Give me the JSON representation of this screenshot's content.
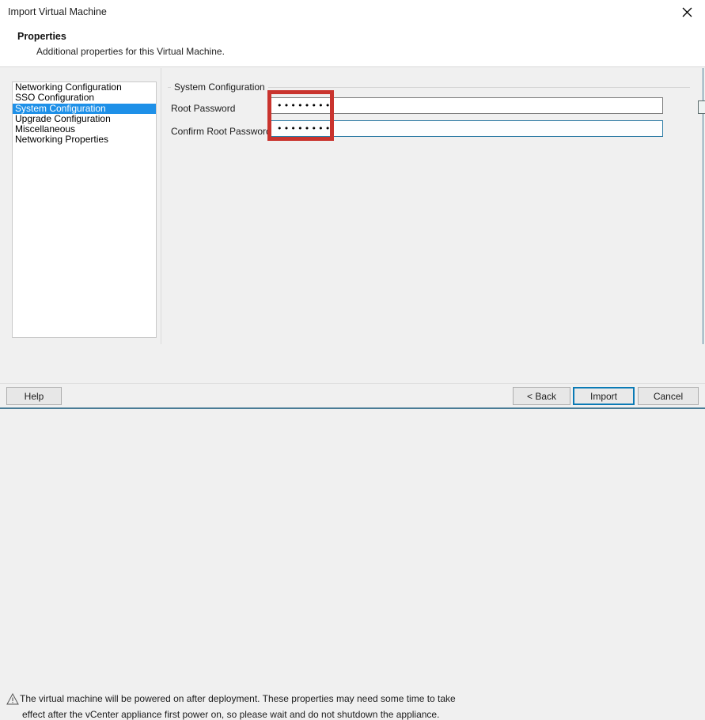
{
  "window": {
    "title": "Import Virtual Machine",
    "close_icon": "close-icon"
  },
  "header": {
    "title": "Properties",
    "subtitle": "Additional properties for this Virtual Machine."
  },
  "sidebar": {
    "items": [
      {
        "label": "Networking Configuration",
        "selected": false
      },
      {
        "label": "SSO Configuration",
        "selected": false
      },
      {
        "label": "System Configuration",
        "selected": true
      },
      {
        "label": "Upgrade Configuration",
        "selected": false
      },
      {
        "label": "Miscellaneous",
        "selected": false
      },
      {
        "label": "Networking Properties",
        "selected": false
      }
    ]
  },
  "form": {
    "group_label": "System Configuration",
    "fields": [
      {
        "label": "Root Password",
        "value": "••••••••",
        "placeholder": "",
        "focused": false
      },
      {
        "label": "Confirm Root Password",
        "value": "••••••••",
        "placeholder": "",
        "focused": true
      }
    ]
  },
  "annotation": {
    "color": "#c9342e",
    "shape": "rectangle-highlight"
  },
  "warning": {
    "icon": "warning-triangle-icon",
    "line1": "The virtual machine will be powered on after deployment. These properties may need some time to take",
    "line2": "effect after the vCenter appliance first power on, so please wait and do not shutdown the appliance."
  },
  "footer": {
    "help_label": "Help",
    "back_label": "< Back",
    "import_label": "Import",
    "cancel_label": "Cancel",
    "focused_button": "Import"
  },
  "colors": {
    "selection_blue": "#1e90e8",
    "focus_blue": "#0a7ab5",
    "annotation_red": "#c9342e",
    "window_bg": "#f0f0f0"
  }
}
